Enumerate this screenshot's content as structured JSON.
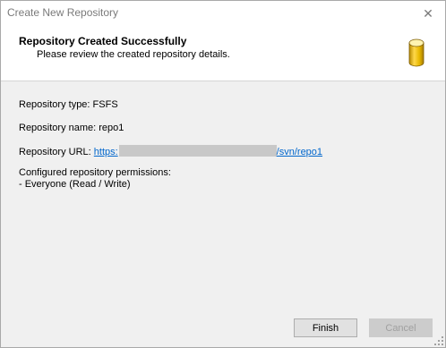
{
  "window": {
    "title": "Create New Repository",
    "close_symbol": "✕"
  },
  "header": {
    "heading": "Repository Created Successfully",
    "subheading": "Please review the created repository details.",
    "icon": "database-icon"
  },
  "details": {
    "type_label": "Repository type: FSFS",
    "name_label": "Repository name: repo1",
    "url_label": "Repository URL: ",
    "url_prefix": "https:",
    "url_suffix": "/svn/repo1",
    "permissions_label": "Configured repository permissions:",
    "permission_entry": "- Everyone (Read / Write)"
  },
  "buttons": {
    "finish": "Finish",
    "cancel": "Cancel"
  },
  "colors": {
    "link": "#0066cc",
    "icon_gold": "#e8b800"
  }
}
